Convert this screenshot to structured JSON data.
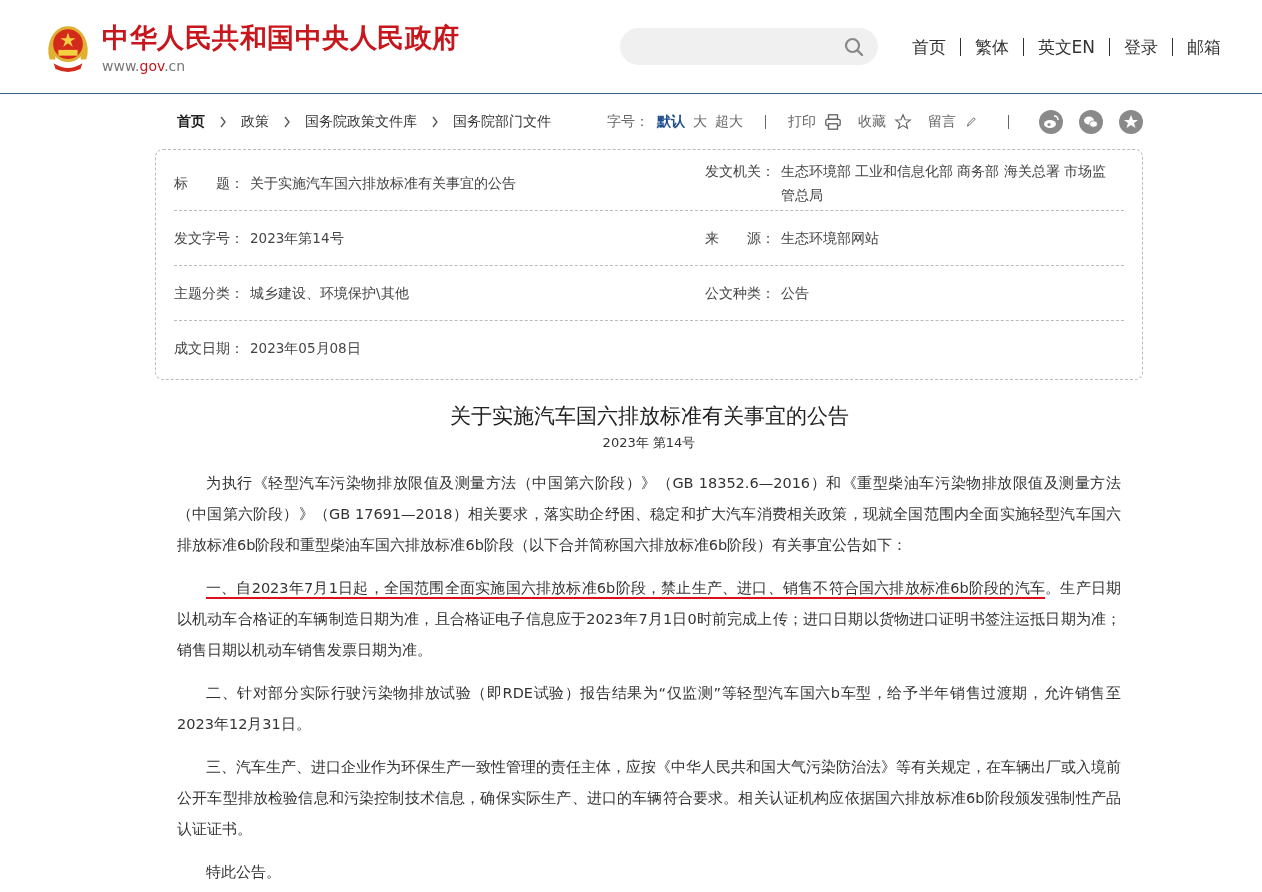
{
  "header": {
    "site_title": "中华人民共和国中央人民政府",
    "domain": [
      {
        "text": "www.",
        "highlight": false
      },
      {
        "text": "gov",
        "highlight": true
      },
      {
        "text": ".cn",
        "highlight": false
      }
    ],
    "nav": [
      "首页",
      "繁体",
      "英文EN",
      "登录",
      "邮箱"
    ]
  },
  "breadcrumb": [
    {
      "label": "首页",
      "current": true
    },
    {
      "label": "政策",
      "current": false
    },
    {
      "label": "国务院政策文件库",
      "current": false
    },
    {
      "label": "国务院部门文件",
      "current": false
    }
  ],
  "font_size": {
    "label": "字号：",
    "options": [
      {
        "label": "默认",
        "selected": true
      },
      {
        "label": "大",
        "selected": false
      },
      {
        "label": "超大",
        "selected": false
      }
    ]
  },
  "tools": [
    {
      "label": "打印",
      "kind": "print"
    },
    {
      "label": "收藏",
      "kind": "star"
    },
    {
      "label": "留言",
      "kind": "pencil"
    }
  ],
  "share": [
    {
      "kind": "weibo"
    },
    {
      "kind": "wechat"
    },
    {
      "kind": "favorite"
    }
  ],
  "info_rows": [
    [
      {
        "label": "标　　题：",
        "value": "关于实施汽车国六排放标准有关事宜的公告"
      },
      {
        "label": "发文机关：",
        "value": "生态环境部 工业和信息化部 商务部 海关总署 市场监管总局"
      }
    ],
    [
      {
        "label": "发文字号：",
        "value": "2023年第14号"
      },
      {
        "label": "来　　源：",
        "value": "生态环境部网站"
      }
    ],
    [
      {
        "label": "主题分类：",
        "value": "城乡建设、环境保护\\其他"
      },
      {
        "label": "公文种类：",
        "value": "公告"
      }
    ],
    [
      {
        "label": "成文日期：",
        "value": "2023年05月08日"
      }
    ]
  ],
  "article": {
    "title": "关于实施汽车国六排放标准有关事宜的公告",
    "number": "2023年 第14号",
    "paragraphs": [
      [
        {
          "text": "为执行《轻型汽车污染物排放限值及测量方法（中国第六阶段）》（GB 18352.6—2016）和《重型柴油车污染物排放限值及测量方法（中国第六阶段）》（GB 17691—2018）相关要求，落实助企纾困、稳定和扩大汽车消费相关政策，现就全国范围内全面实施轻型汽车国六排放标准6b阶段和重型柴油车国六排放标准6b阶段（以下合并简称国六排放标准6b阶段）有关事宜公告如下：",
          "underlined": false
        }
      ],
      [
        {
          "text": "一、自2023年7月1日起，全国范围全面实施国六排放标准6b阶段，禁止生产、进口、销售不符合国六排放标准6b阶段的汽车",
          "underlined": true
        },
        {
          "text": "。生产日期以机动车合格证的车辆制造日期为准，且合格证电子信息应于2023年7月1日0时前完成上传；进口日期以货物进口证明书签注运抵日期为准；销售日期以机动车销售发票日期为准。",
          "underlined": false
        }
      ],
      [
        {
          "text": "二、针对部分实际行驶污染物排放试验（即RDE试验）报告结果为“仅监测”等轻型汽车国六b车型，给予半年销售过渡期，允许销售至2023年12月31日。",
          "underlined": false
        }
      ],
      [
        {
          "text": "三、汽车生产、进口企业作为环保生产一致性管理的责任主体，应按《中华人民共和国大气污染防治法》等有关规定，在车辆出厂或入境前公开车型排放检验信息和污染控制技术信息，确保实际生产、进口的车辆符合要求。相关认证机构应依据国六排放标准6b阶段颁发强制性产品认证证书。",
          "underlined": false
        }
      ],
      [
        {
          "text": "特此公告。",
          "underlined": false
        }
      ]
    ]
  }
}
